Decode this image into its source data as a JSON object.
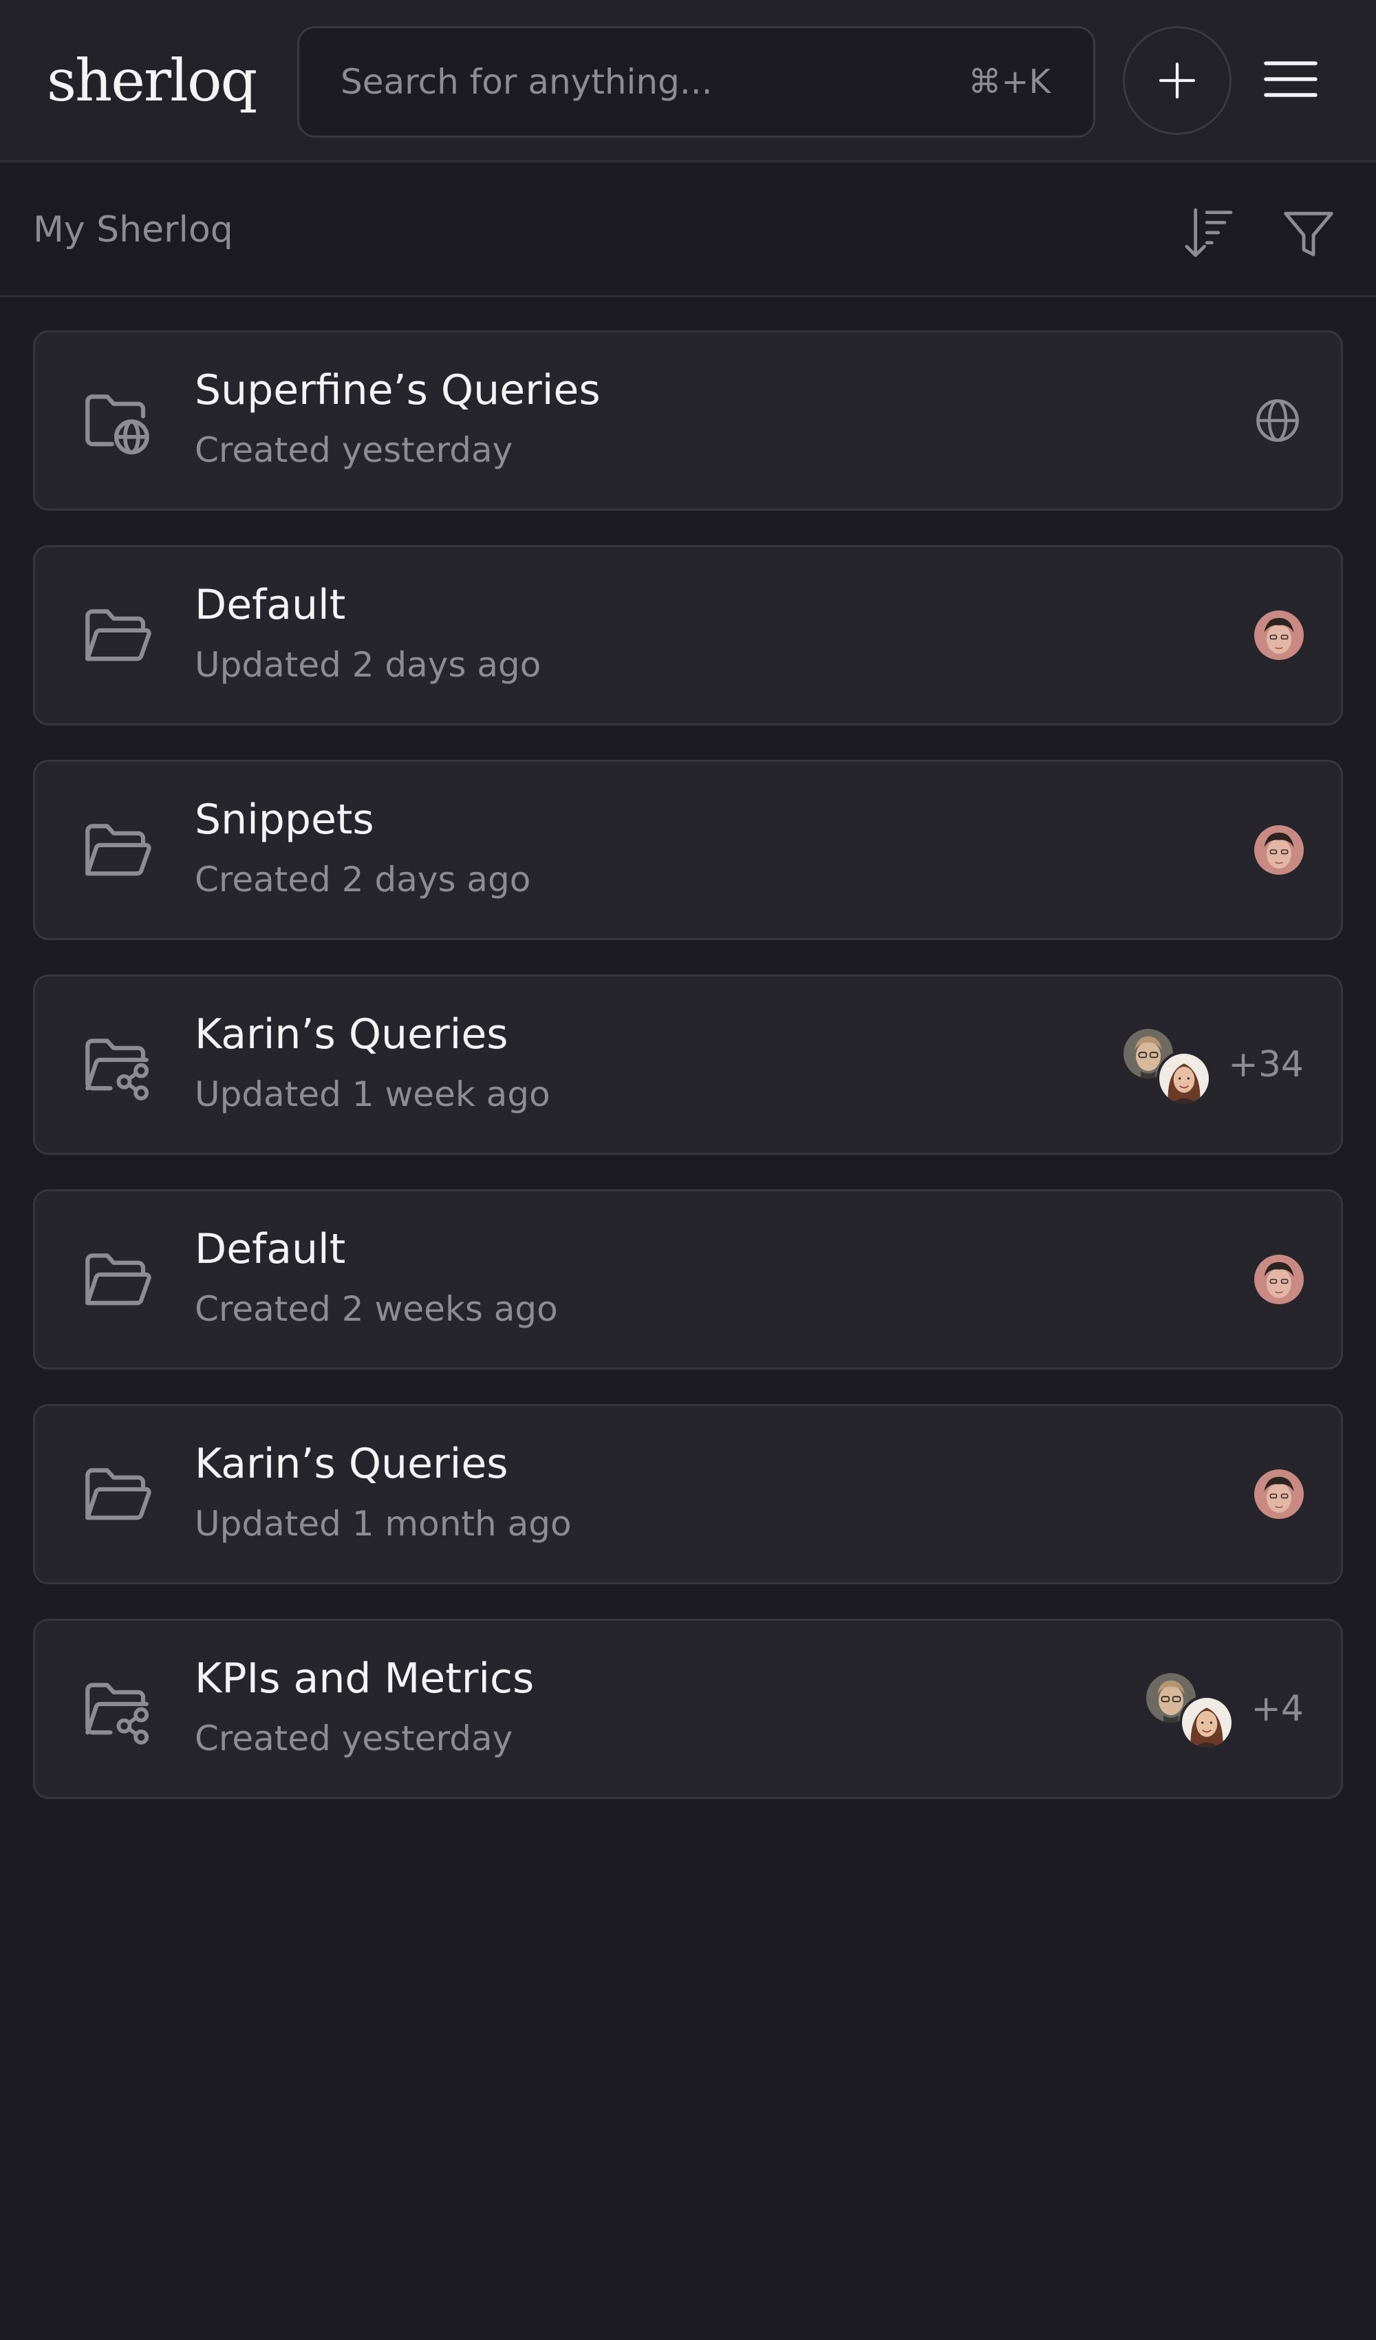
{
  "header": {
    "logo": "sherloq",
    "search_placeholder": "Search for anything...",
    "search_shortcut": "⌘+K",
    "add_icon": "plus-icon",
    "menu_icon": "hamburger-menu-icon"
  },
  "subheader": {
    "title": "My Sherloq",
    "sort_icon": "sort-descending-icon",
    "filter_icon": "filter-icon"
  },
  "items": [
    {
      "title": "Superfine’s Queries",
      "subtitle": "Created yesterday",
      "icon": "folder-globe-icon",
      "right": "public-globe-icon"
    },
    {
      "title": "Default",
      "subtitle": "Updated 2 days ago",
      "icon": "folder-icon",
      "right": "owner-avatar"
    },
    {
      "title": "Snippets",
      "subtitle": "Created 2 days ago",
      "icon": "folder-icon",
      "right": "owner-avatar"
    },
    {
      "title": "Karin’s Queries",
      "subtitle": "Updated 1 week ago",
      "icon": "folder-share-icon",
      "right": "shared-avatars",
      "shared_count": "+34"
    },
    {
      "title": "Default",
      "subtitle": "Created 2 weeks ago",
      "icon": "folder-icon",
      "right": "owner-avatar"
    },
    {
      "title": "Karin’s Queries",
      "subtitle": "Updated 1 month ago",
      "icon": "folder-icon",
      "right": "owner-avatar"
    },
    {
      "title": "KPIs and Metrics",
      "subtitle": "Created yesterday",
      "icon": "folder-share-icon",
      "right": "shared-avatars",
      "shared_count": "+4"
    }
  ],
  "colors": {
    "background": "#1c1b21",
    "card": "#26252b",
    "border": "#37363d",
    "text_primary": "#f4f4f6",
    "text_secondary": "#8d8c95"
  }
}
